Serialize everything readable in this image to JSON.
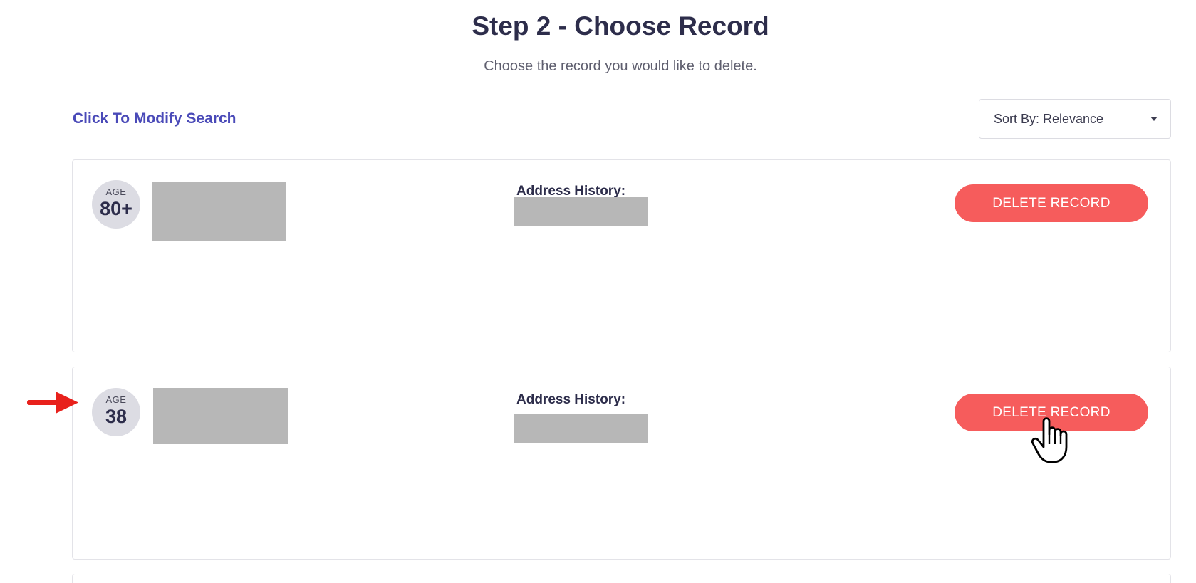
{
  "header": {
    "title": "Step 2 - Choose Record",
    "subtitle": "Choose the record you would like to delete."
  },
  "toolbar": {
    "modify_search_label": "Click To Modify Search",
    "sort_label": "Sort By: Relevance"
  },
  "records": [
    {
      "age_label": "AGE",
      "age_value": "80+",
      "address_label": "Address History:",
      "delete_label": "DELETE RECORD"
    },
    {
      "age_label": "AGE",
      "age_value": "38",
      "address_label": "Address History:",
      "delete_label": "DELETE RECORD"
    }
  ],
  "colors": {
    "accent_link": "#4a4ab8",
    "delete_button": "#f65c5c",
    "heading": "#2d2d4b",
    "redaction": "#b7b7b7",
    "annotation_arrow": "#e8211c"
  },
  "icons": {
    "sort": "caret-down-icon",
    "annotation": "red-arrow-icon",
    "pointer": "hand-cursor-icon"
  }
}
